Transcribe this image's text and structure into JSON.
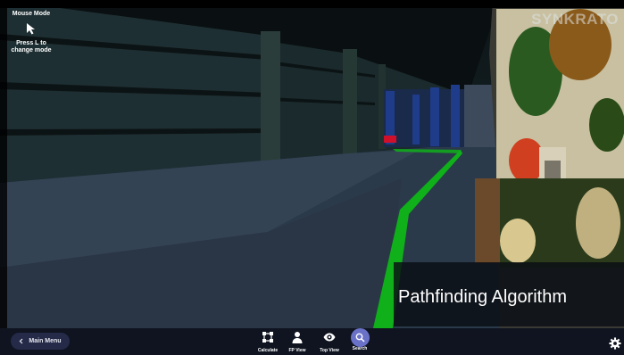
{
  "mode_hint": {
    "title": "Mouse Mode",
    "instruction": "Press L to change mode",
    "icon": "cursor-arrow-icon"
  },
  "brand": "SYNKRATO",
  "banner": {
    "title": "Pathfinding Algorithm"
  },
  "toolbar": {
    "main_menu": {
      "label": "Main Menu",
      "icon": "chevron-left-icon"
    },
    "tools": [
      {
        "label": "Calculate",
        "icon": "nodes-icon"
      },
      {
        "label": "FP View",
        "icon": "person-icon"
      },
      {
        "label": "Top View",
        "icon": "eye-icon"
      },
      {
        "label": "Search",
        "icon": "search-icon"
      }
    ],
    "settings_icon": "gear-icon"
  },
  "colors": {
    "path": "#0fb01a",
    "toolbar_bg": "#0f1420",
    "button_bg": "#252a48",
    "search_accent": "#6a72c8"
  }
}
